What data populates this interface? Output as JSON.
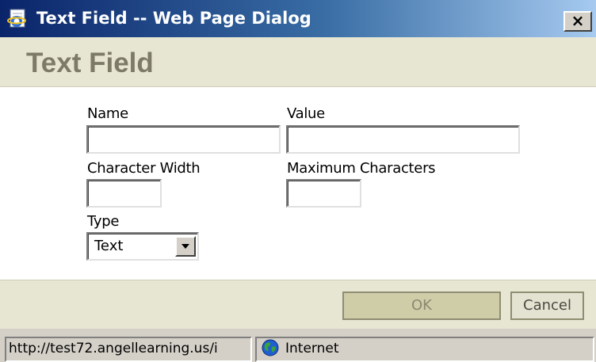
{
  "window": {
    "title": "Text Field -- Web Page Dialog",
    "close_label": "×"
  },
  "header": {
    "title": "Text Field"
  },
  "form": {
    "name_label": "Name",
    "name_value": "",
    "value_label": "Value",
    "value_value": "",
    "char_width_label": "Character Width",
    "char_width_value": "",
    "max_chars_label": "Maximum Characters",
    "max_chars_value": "",
    "type_label": "Type",
    "type_selected": "Text"
  },
  "footer": {
    "ok_label": "OK",
    "cancel_label": "Cancel"
  },
  "statusbar": {
    "url": "http://test72.angellearning.us/i",
    "zone": "Internet"
  },
  "colors": {
    "titlebar_start": "#0a246a",
    "titlebar_end": "#a6caf0",
    "band": "#e7e6d3",
    "header_text": "#7d7a66",
    "ok_button": "#cfcda8"
  },
  "icons": {
    "title": "ie-page-icon",
    "close": "close-icon",
    "dropdown": "chevron-down-icon",
    "zone": "globe-icon"
  }
}
